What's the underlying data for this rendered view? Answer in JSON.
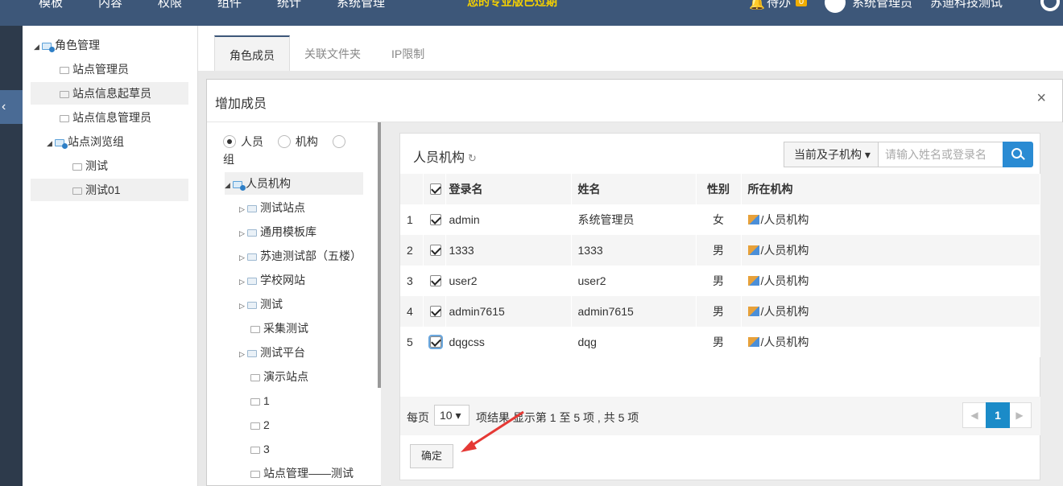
{
  "topnav": {
    "items": [
      "模板",
      "内容",
      "权限",
      "组件",
      "统计",
      "系统管理"
    ],
    "notice": "您的专业版已过期",
    "todo_label": "待办",
    "todo_count": "0",
    "user_name": "系统管理员",
    "org_name": "苏迪科技测试"
  },
  "role_tree": {
    "items": [
      "角色管理",
      "站点管理员",
      "站点信息起草员",
      "站点信息管理员",
      "站点浏览组",
      "测试",
      "测试01"
    ]
  },
  "tabs": [
    "角色成员",
    "关联文件夹",
    "IP限制"
  ],
  "modal": {
    "title": "增加成员",
    "close": "×",
    "radio": {
      "person": "人员",
      "org": "机构",
      "group": "组"
    },
    "org_tree": [
      "人员机构",
      "测试站点",
      "通用模板库",
      "苏迪测试部（五楼）",
      "学校网站",
      "测试",
      "采集测试",
      "测试平台",
      "演示站点",
      "1",
      "2",
      "3",
      "站点管理——测试"
    ],
    "panel_title": "人员机构",
    "scope": "当前及子机构",
    "search_placeholder": "请输入姓名或登录名",
    "columns": [
      "登录名",
      "姓名",
      "性别",
      "所在机构"
    ],
    "rows": [
      {
        "no": "1",
        "login": "admin",
        "name": "系统管理员",
        "gender": "女",
        "org": "/人员机构"
      },
      {
        "no": "2",
        "login": "1333",
        "name": "1333",
        "gender": "男",
        "org": "/人员机构"
      },
      {
        "no": "3",
        "login": "user2",
        "name": "user2",
        "gender": "男",
        "org": "/人员机构"
      },
      {
        "no": "4",
        "login": "admin7615",
        "name": "admin7615",
        "gender": "男",
        "org": "/人员机构"
      },
      {
        "no": "5",
        "login": "dqgcss",
        "name": "dqg",
        "gender": "男",
        "org": "/人员机构"
      }
    ],
    "per_page_label": "每页",
    "per_page": "10",
    "page_info": "项结果   显示第 1 至 5 项 , 共 5 项",
    "current_page": "1",
    "ok": "确定"
  },
  "colors": {
    "nav": "#3d5779",
    "accent": "#2a8bd3",
    "pager": "#1b8bc8",
    "arrow": "#e53935"
  }
}
